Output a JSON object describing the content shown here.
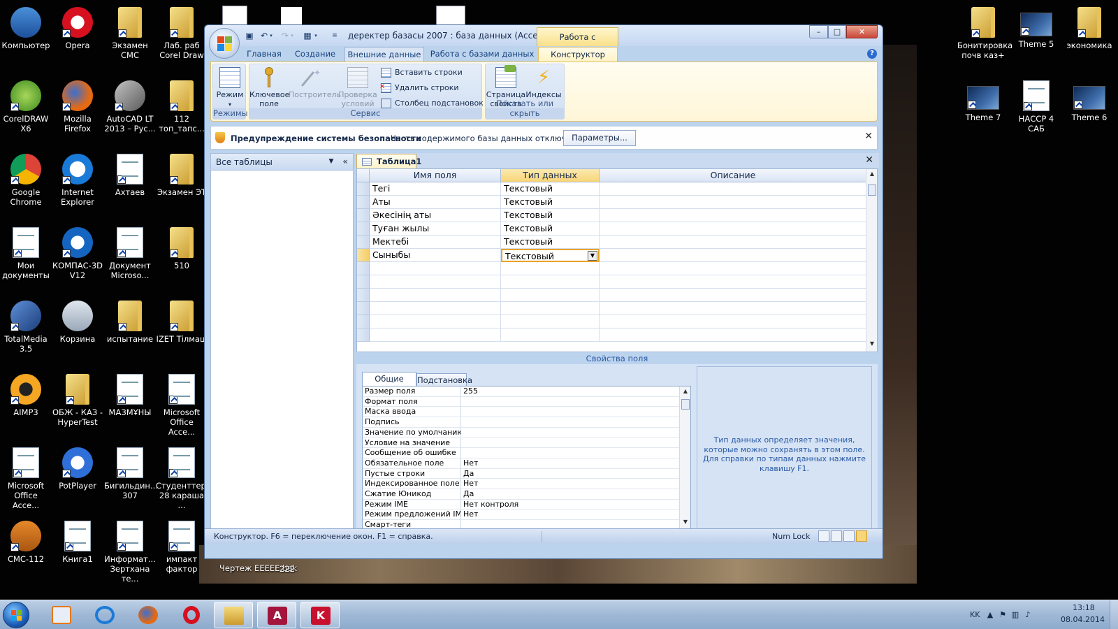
{
  "desktop_left": [
    {
      "label": "Компьютер",
      "icon": "computer-icon"
    },
    {
      "label": "Opera",
      "icon": "opera-icon"
    },
    {
      "label": "Экзамен СМС",
      "icon": "folder-icon"
    },
    {
      "label": "Лаб. раб Corel Draw",
      "icon": "folder-icon"
    },
    {
      "label": "CorelDRAW X6",
      "icon": "coreldraw-icon"
    },
    {
      "label": "Mozilla Firefox",
      "icon": "firefox-icon"
    },
    {
      "label": "AutoCAD LT 2013 – Рус...",
      "icon": "autocad-icon"
    },
    {
      "label": "112 топ_тапс...",
      "icon": "folder-icon"
    },
    {
      "label": "Google Chrome",
      "icon": "chrome-icon"
    },
    {
      "label": "Internet Explorer",
      "icon": "ie-icon"
    },
    {
      "label": "Ахтаев",
      "icon": "access-file-icon"
    },
    {
      "label": "Экзамен ЭТ",
      "icon": "folder-icon"
    },
    {
      "label": "Мои документы",
      "icon": "documents-icon"
    },
    {
      "label": "КОМПАС-3D V12",
      "icon": "kompas-icon"
    },
    {
      "label": "Документ Microso...",
      "icon": "document-icon"
    },
    {
      "label": "510",
      "icon": "folder-icon"
    },
    {
      "label": "TotalMedia 3.5",
      "icon": "totalmedia-icon"
    },
    {
      "label": "Корзина",
      "icon": "recycle-bin-icon"
    },
    {
      "label": "испытание",
      "icon": "folder-icon"
    },
    {
      "label": "IZET Тілмаш",
      "icon": "folder-icon"
    },
    {
      "label": "AIMP3",
      "icon": "aimp-icon"
    },
    {
      "label": "ОБЖ - КАЗ - HyperTest",
      "icon": "folder-icon"
    },
    {
      "label": "МАЗМҰНЫ",
      "icon": "word-file-icon"
    },
    {
      "label": "Microsoft Office Acce...",
      "icon": "access-file-icon"
    },
    {
      "label": "Microsoft Office Acce...",
      "icon": "access-file-icon"
    },
    {
      "label": "PotPlayer",
      "icon": "potplayer-icon"
    },
    {
      "label": "Бигильдин... 307",
      "icon": "access-file-icon"
    },
    {
      "label": "Студенттерге 28 караша ...",
      "icon": "word-file-icon"
    },
    {
      "label": "СМС-112",
      "icon": "briefcase-icon"
    },
    {
      "label": "Книга1",
      "icon": "excel-file-icon"
    },
    {
      "label": "Информат... Зертхана те...",
      "icon": "word-file-icon"
    },
    {
      "label": "импакт фактор",
      "icon": "pdf-file-icon"
    }
  ],
  "desktop_right": [
    {
      "label": "Бонитировка почв каз+",
      "icon": "folder-icon"
    },
    {
      "label": "Theme 5",
      "icon": "powerpoint-file-icon"
    },
    {
      "label": "экономика",
      "icon": "folder-icon"
    },
    {
      "label": "Theme 7",
      "icon": "powerpoint-file-icon"
    },
    {
      "label": "НАССР 4 САБ",
      "icon": "word-file-icon"
    },
    {
      "label": "Theme 6",
      "icon": "powerpoint-file-icon"
    }
  ],
  "desktop_extra": {
    "chertezh": "Чертеж ЕЕЕЕЕ.bak",
    "n222": "222"
  },
  "window": {
    "title": "деректер базасы 2007 : база данных (Access 20...",
    "context_tab": "Работа с таблицами",
    "controls": {
      "minimize": "–",
      "maximize": "□",
      "close": "✕"
    }
  },
  "ribbon_tabs": [
    "Главная",
    "Создание",
    "Внешние данные",
    "Работа с базами данных",
    "Конструктор"
  ],
  "ribbon": {
    "groups": {
      "modes": "Режимы",
      "service": "Сервис",
      "show_hide": "Показать или скрыть"
    },
    "mode_button": "Режим",
    "key_field": "Ключевое поле",
    "builder": "Построитель",
    "validation": "Проверка условий",
    "insert_rows": "Вставить строки",
    "delete_rows": "Удалить строки",
    "lookup_column": "Столбец подстановок",
    "property_sheet": "Страница свойств",
    "indexes": "Индексы"
  },
  "security": {
    "title": "Предупреждение системы безопасности",
    "message": "Часть содержимого базы данных отключено",
    "button": "Параметры..."
  },
  "nav": {
    "title": "Все таблицы",
    "collapse": "«"
  },
  "doc": {
    "tab": "Таблица1"
  },
  "grid": {
    "headers": [
      "Имя поля",
      "Тип данных",
      "Описание"
    ],
    "rows": [
      {
        "name": "Тегі",
        "type": "Текстовый",
        "desc": ""
      },
      {
        "name": "Аты",
        "type": "Текстовый",
        "desc": ""
      },
      {
        "name": "Әкесінің аты",
        "type": "Текстовый",
        "desc": ""
      },
      {
        "name": "Туған жылы",
        "type": "Текстовый",
        "desc": ""
      },
      {
        "name": "Мектебі",
        "type": "Текстовый",
        "desc": ""
      },
      {
        "name": "Сыныбы",
        "type": "Текстовый",
        "desc": ""
      }
    ]
  },
  "field_props": {
    "label": "Свойства поля",
    "tabs": [
      "Общие",
      "Подстановка"
    ],
    "rows": [
      {
        "label": "Размер поля",
        "value": "255"
      },
      {
        "label": "Формат поля",
        "value": ""
      },
      {
        "label": "Маска ввода",
        "value": ""
      },
      {
        "label": "Подпись",
        "value": ""
      },
      {
        "label": "Значение по умолчанию",
        "value": ""
      },
      {
        "label": "Условие на значение",
        "value": ""
      },
      {
        "label": "Сообщение об ошибке",
        "value": ""
      },
      {
        "label": "Обязательное поле",
        "value": "Нет"
      },
      {
        "label": "Пустые строки",
        "value": "Да"
      },
      {
        "label": "Индексированное поле",
        "value": "Нет"
      },
      {
        "label": "Сжатие Юникод",
        "value": "Да"
      },
      {
        "label": "Режим IME",
        "value": "Нет контроля"
      },
      {
        "label": "Режим предложений IME",
        "value": "Нет"
      },
      {
        "label": "Смарт-теги",
        "value": ""
      }
    ],
    "help": "Тип данных определяет значения, которые можно сохранять в этом поле. Для справки по типам данных нажмите клавишу F1."
  },
  "status": {
    "text": "Конструктор. F6 = переключение окон. F1 = справка.",
    "numlock": "Num Lock"
  },
  "taskbar": {
    "lang": "KK",
    "time": "13:18",
    "date": "08.04.2014"
  }
}
